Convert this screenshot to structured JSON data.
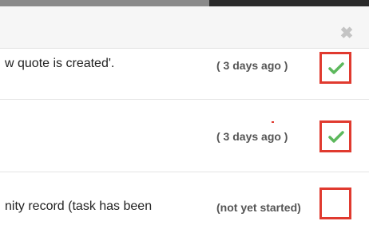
{
  "dialog": {
    "close_glyph": "✖",
    "tasks": [
      {
        "description": "w quote is created'.",
        "status": "( 3 days ago )",
        "completed": true
      },
      {
        "description": "",
        "status": "( 3 days ago )",
        "completed": true
      },
      {
        "description": "nity record (task has been",
        "status": "(not yet started)",
        "completed": false
      }
    ]
  },
  "colors": {
    "highlight": "#e03a2f",
    "check": "#5cb85c"
  },
  "icons": {
    "close": "close-icon",
    "check": "checkmark-icon"
  }
}
